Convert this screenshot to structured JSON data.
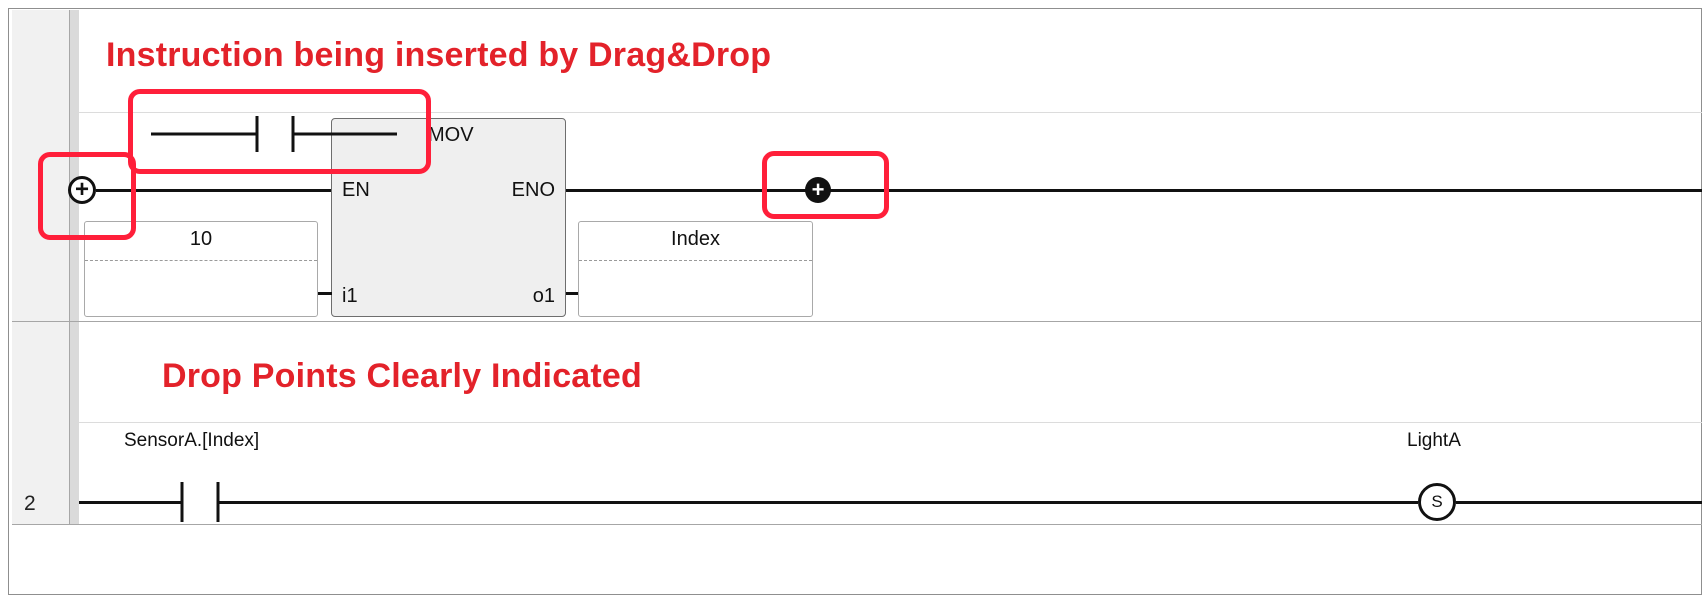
{
  "callouts": {
    "instruction_title": "Instruction being inserted by Drag&Drop",
    "drop_points_title": "Drop Points Clearly Indicated"
  },
  "rung1": {
    "instruction_name": "MOV",
    "pins": {
      "en": "EN",
      "eno": "ENO",
      "in1": "i1",
      "out1": "o1"
    },
    "input_operand": "10",
    "output_operand": "Index"
  },
  "rung2": {
    "number": "2",
    "contact_variable": "SensorA.[Index]",
    "coil_variable": "LightA",
    "coil_type": "S"
  },
  "icons": {
    "drop_point": "circled-plus-icon",
    "dragged_contact": "contact-no-icon",
    "coil": "set-coil-icon"
  },
  "colors": {
    "callout_text": "#e3222a",
    "highlight": "#ff1f3a",
    "wire": "#111111",
    "block_fill": "#efefef"
  }
}
